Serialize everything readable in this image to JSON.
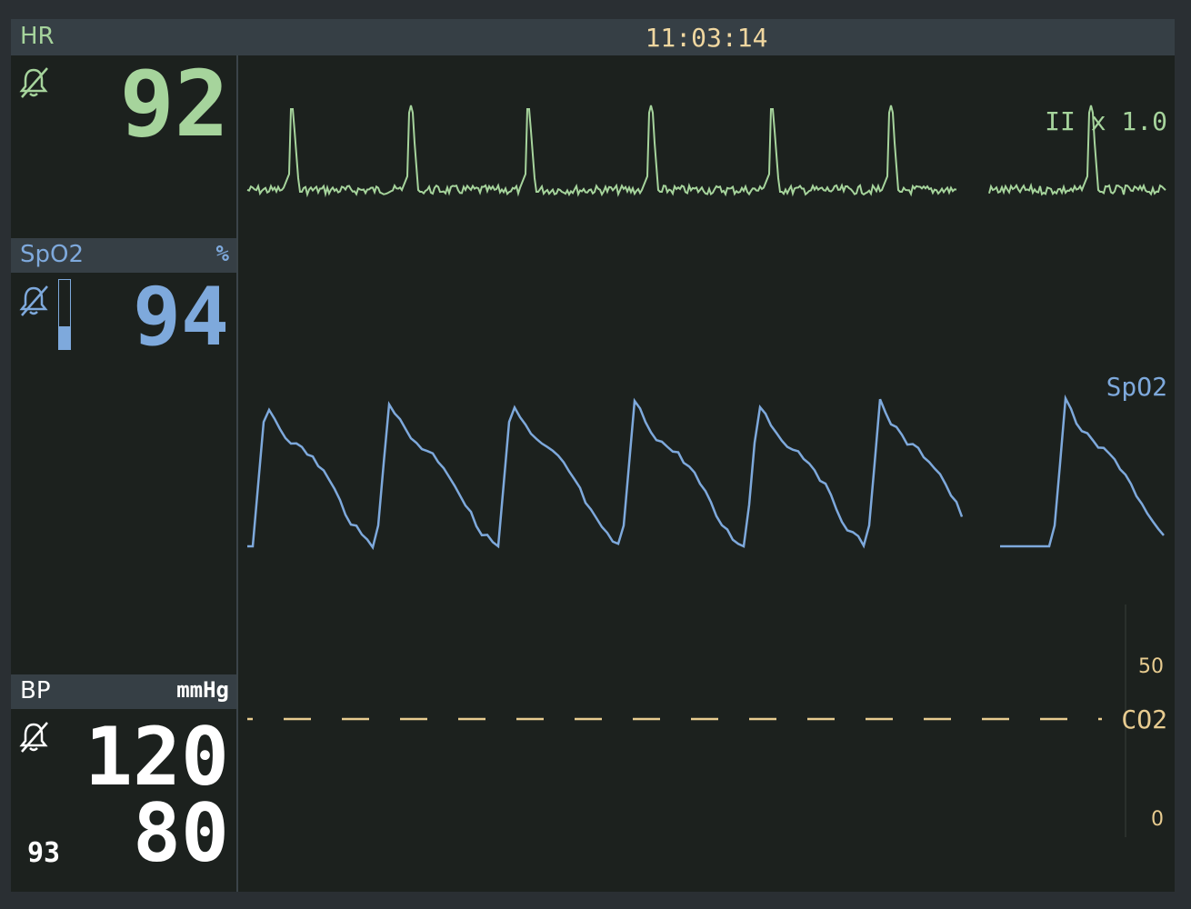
{
  "clock": "11:03:14",
  "hr": {
    "label": "HR",
    "value": "92",
    "alarm_icon": "bell-muted-icon",
    "color": "#a6d49c"
  },
  "spo2": {
    "label": "SpO2",
    "unit": "%",
    "value": "94",
    "alarm_icon": "bell-muted-icon",
    "color": "#7ea9dc",
    "bar_level": 0.33
  },
  "bp": {
    "label": "BP",
    "unit": "mmHg",
    "systolic": "120",
    "diastolic": "80",
    "mean": "93",
    "alarm_icon": "bell-muted-icon",
    "color": "#ffffff"
  },
  "waves": {
    "ecg_label": "II x 1.0",
    "pleth_label": "SpO2",
    "co2_label": "CO2",
    "co2_scale_top": "50",
    "co2_scale_bottom": "0",
    "co2_color": "#e8cc90"
  }
}
